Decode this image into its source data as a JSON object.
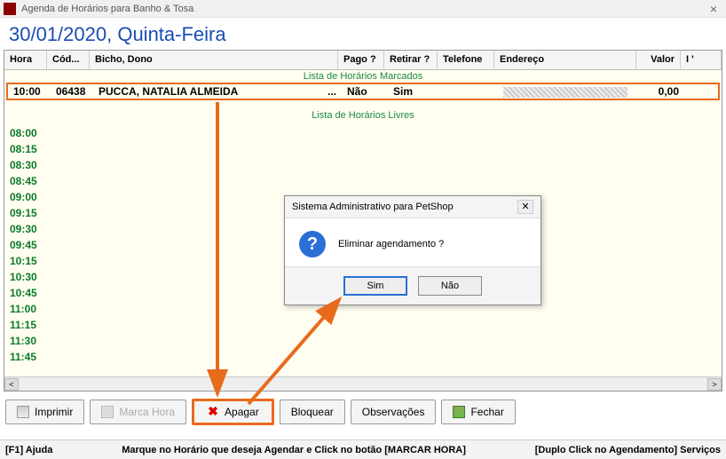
{
  "window": {
    "title": "Agenda de Horários para Banho & Tosa",
    "close": "×"
  },
  "date_heading": "30/01/2020, Quinta-Feira",
  "columns": {
    "hora": "Hora",
    "cod": "Cód...",
    "bicho": "Bicho, Dono",
    "pago": "Pago ?",
    "retirar": "Retirar ?",
    "telefone": "Telefone",
    "endereco": "Endereço",
    "valor": "Valor",
    "last": "I '"
  },
  "sections": {
    "booked": "Lista de Horários Marcados",
    "free": "Lista de Horários Livres"
  },
  "booked": [
    {
      "hora": "10:00",
      "cod": "06438",
      "bicho": "PUCCA, NATALIA ALMEIDA",
      "dots": "...",
      "pago": "Não",
      "retirar": "Sim",
      "telefone": "",
      "endereco": "",
      "valor": "0,00"
    }
  ],
  "free_times": [
    "08:00",
    "08:15",
    "08:30",
    "08:45",
    "09:00",
    "09:15",
    "09:30",
    "09:45",
    "10:15",
    "10:30",
    "10:45",
    "11:00",
    "11:15",
    "11:30",
    "11:45"
  ],
  "toolbar": {
    "imprimir": "Imprimir",
    "marca": "Marca Hora",
    "apagar": "Apagar",
    "bloquear": "Bloquear",
    "observacoes": "Observações",
    "fechar": "Fechar"
  },
  "status": {
    "left": "[F1] Ajuda",
    "mid": "Marque no Horário que deseja Agendar e Click no botão [MARCAR HORA]",
    "right": "[Duplo Click no Agendamento] Serviços"
  },
  "dialog": {
    "title": "Sistema Administrativo para PetShop",
    "message": "Eliminar agendamento ?",
    "yes": "Sim",
    "no": "Não",
    "close": "✕"
  }
}
